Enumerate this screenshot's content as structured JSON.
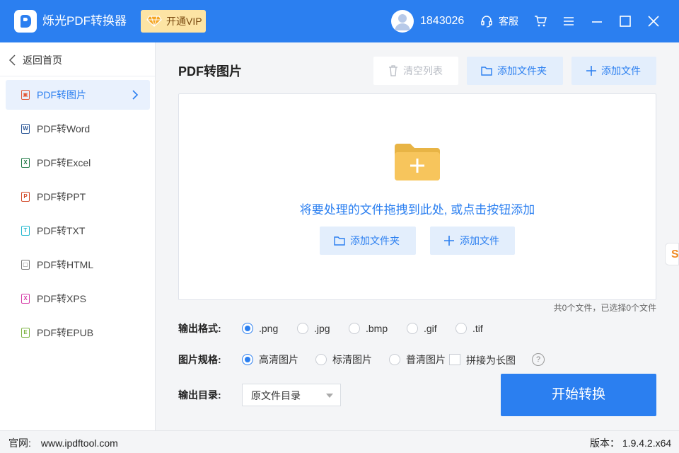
{
  "app": {
    "name": "烁光PDF转换器",
    "vip_label": "开通VIP"
  },
  "user": {
    "id": "1843026",
    "service_label": "客服"
  },
  "sidebar": {
    "back_label": "返回首页",
    "items": [
      {
        "label": "PDF转图片",
        "icon": "image-file-icon",
        "color": "#e25a3a",
        "glyph": "▣"
      },
      {
        "label": "PDF转Word",
        "icon": "word-file-icon",
        "color": "#2b5797",
        "glyph": "W"
      },
      {
        "label": "PDF转Excel",
        "icon": "excel-file-icon",
        "color": "#1f7a45",
        "glyph": "X"
      },
      {
        "label": "PDF转PPT",
        "icon": "ppt-file-icon",
        "color": "#d24726",
        "glyph": "P"
      },
      {
        "label": "PDF转TXT",
        "icon": "txt-file-icon",
        "color": "#22b8cf",
        "glyph": "T"
      },
      {
        "label": "PDF转HTML",
        "icon": "html-file-icon",
        "color": "#777777",
        "glyph": "▢"
      },
      {
        "label": "PDF转XPS",
        "icon": "xps-file-icon",
        "color": "#d63ca8",
        "glyph": "X"
      },
      {
        "label": "PDF转EPUB",
        "icon": "epub-file-icon",
        "color": "#7cb342",
        "glyph": "E"
      }
    ]
  },
  "main": {
    "title": "PDF转图片",
    "clear_label": "清空列表",
    "add_folder_label": "添加文件夹",
    "add_file_label": "添加文件",
    "drop_hint": "将要处理的文件拖拽到此处, 或点击按钮添加",
    "file_count": "共0个文件，已选择0个文件"
  },
  "format": {
    "label": "输出格式:",
    "options": [
      ".png",
      ".jpg",
      ".bmp",
      ".gif",
      ".tif"
    ],
    "selected": ".png"
  },
  "spec": {
    "label": "图片规格:",
    "options": [
      "高清图片",
      "标清图片",
      "普清图片"
    ],
    "selected": "高清图片",
    "stitch_label": "拼接为长图",
    "stitch_checked": false
  },
  "output": {
    "label": "输出目录:",
    "value": "原文件目录"
  },
  "start_label": "开始转换",
  "footer": {
    "site_label": "官网:",
    "site_url": "www.ipdftool.com",
    "version_text": "版本： 1.9.4.2.x64"
  },
  "float_widget": {
    "glyph": "S"
  },
  "colors": {
    "accent": "#2b7ff0",
    "vip_bg": "#fde4a4",
    "folder": "#f7c55c"
  }
}
